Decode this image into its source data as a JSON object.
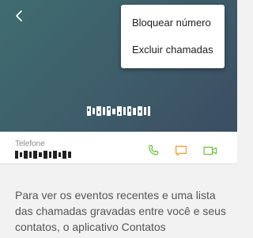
{
  "header": {
    "back_icon": "back-arrow-icon",
    "background_start": "#3f6d70",
    "background_end": "#3c4e62"
  },
  "menu": {
    "items": [
      {
        "label": "Bloquear número"
      },
      {
        "label": "Excluir chamadas"
      }
    ]
  },
  "contact": {
    "phone_label": "Telefone",
    "actions": [
      {
        "name": "phone-icon",
        "color": "#6bbf3c"
      },
      {
        "name": "message-icon",
        "color": "#f0992b"
      },
      {
        "name": "video-icon",
        "color": "#6bbf3c"
      }
    ]
  },
  "info": {
    "text": "Para ver os eventos recentes e uma lista das chamadas gravadas entre você e seus contatos, o aplicativo Contatos"
  }
}
